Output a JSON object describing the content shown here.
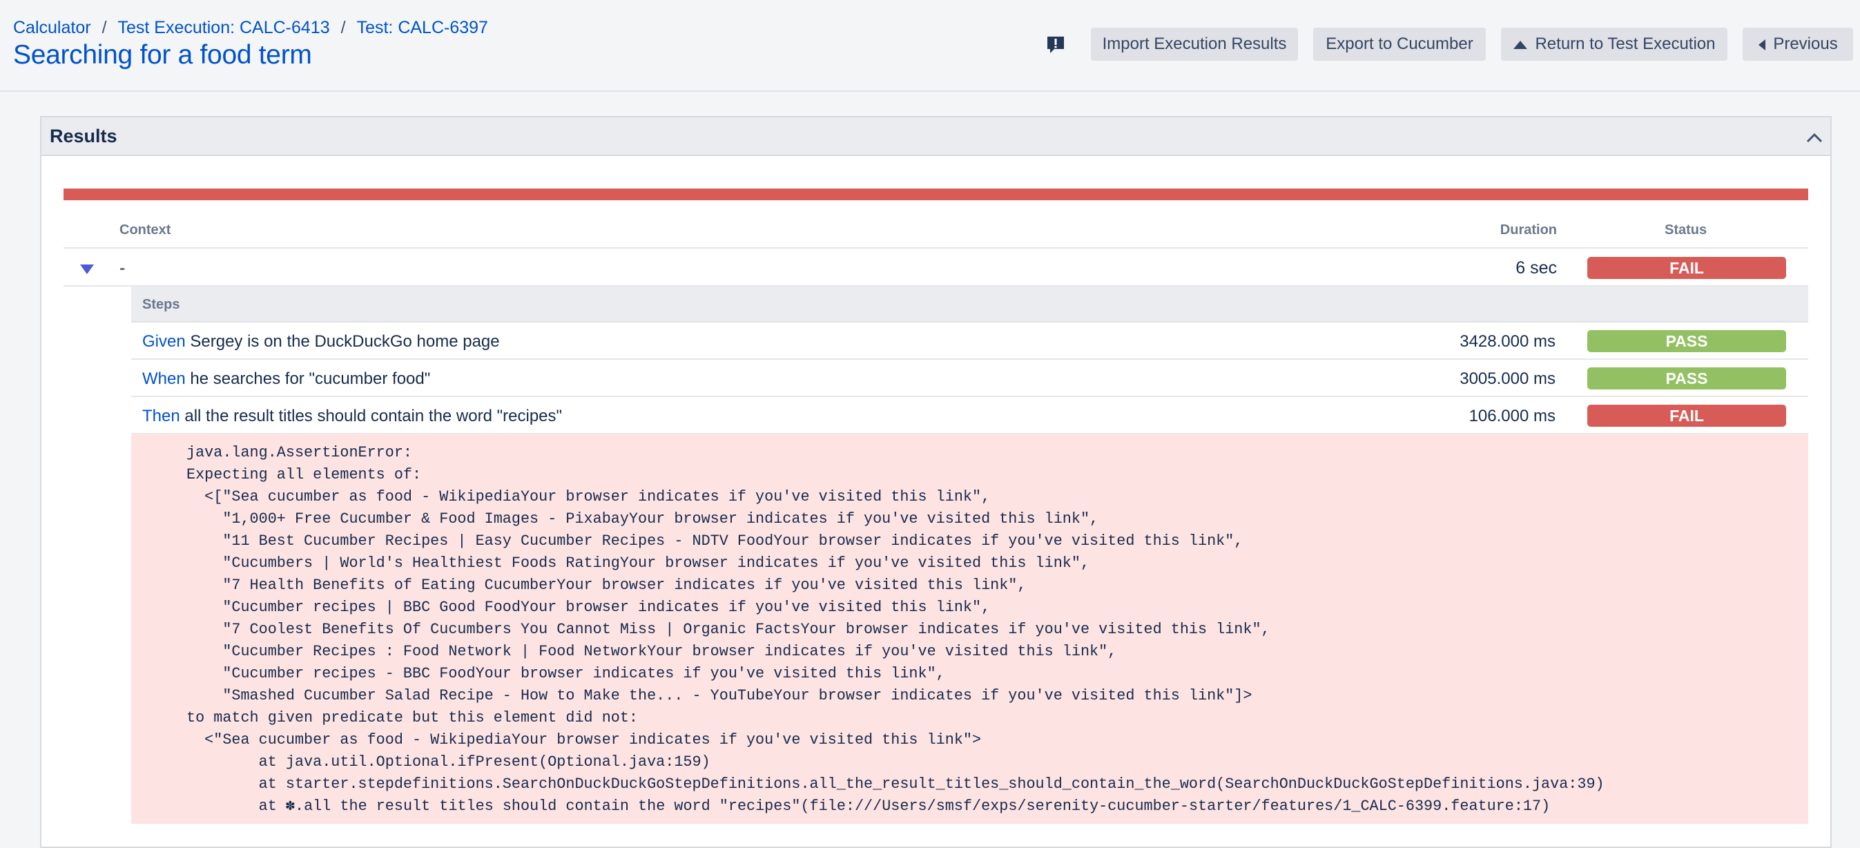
{
  "breadcrumb": {
    "items": [
      "Calculator",
      "Test Execution: CALC-6413",
      "Test: CALC-6397"
    ],
    "separator": "/"
  },
  "page_title": "Searching for a food term",
  "toolbar": {
    "feedback_icon": "feedback-icon",
    "import_label": "Import Execution Results",
    "export_label": "Export to Cucumber",
    "return_label": "Return to Test Execution",
    "return_icon": "up-triangle-icon",
    "previous_label": "Previous",
    "previous_icon": "left-triangle-icon"
  },
  "results": {
    "title": "Results",
    "collapse_icon": "chevron-up-icon",
    "overall_status_color": "#d75c57",
    "columns": {
      "context": "Context",
      "duration": "Duration",
      "status": "Status"
    },
    "context_row": {
      "context": "-",
      "duration": "6 sec",
      "status": "FAIL"
    },
    "steps_header": "Steps",
    "steps": [
      {
        "keyword": "Given",
        "text": " Sergey is on the DuckDuckGo home page",
        "duration": "3428.000 ms",
        "status": "PASS"
      },
      {
        "keyword": "When",
        "text": " he searches for \"cucumber food\"",
        "duration": "3005.000 ms",
        "status": "PASS"
      },
      {
        "keyword": "Then",
        "text": " all the result titles should contain the word \"recipes\"",
        "duration": "106.000 ms",
        "status": "FAIL"
      }
    ],
    "error_lines": [
      "java.lang.AssertionError:",
      "Expecting all elements of:",
      "  <[\"Sea cucumber as food - WikipediaYour browser indicates if you've visited this link\",",
      "    \"1,000+ Free Cucumber & Food Images - PixabayYour browser indicates if you've visited this link\",",
      "    \"11 Best Cucumber Recipes | Easy Cucumber Recipes - NDTV FoodYour browser indicates if you've visited this link\",",
      "    \"Cucumbers | World's Healthiest Foods RatingYour browser indicates if you've visited this link\",",
      "    \"7 Health Benefits of Eating CucumberYour browser indicates if you've visited this link\",",
      "    \"Cucumber recipes | BBC Good FoodYour browser indicates if you've visited this link\",",
      "    \"7 Coolest Benefits Of Cucumbers You Cannot Miss | Organic FactsYour browser indicates if you've visited this link\",",
      "    \"Cucumber Recipes : Food Network | Food NetworkYour browser indicates if you've visited this link\",",
      "    \"Cucumber recipes - BBC FoodYour browser indicates if you've visited this link\",",
      "    \"Smashed Cucumber Salad Recipe - How to Make the... - YouTubeYour browser indicates if you've visited this link\"]>",
      "to match given predicate but this element did not:",
      "  <\"Sea cucumber as food - WikipediaYour browser indicates if you've visited this link\">",
      "        at java.util.Optional.ifPresent(Optional.java:159)",
      "        at starter.stepdefinitions.SearchOnDuckDuckGoStepDefinitions.all_the_result_titles_should_contain_the_word(SearchOnDuckDuckGoStepDefinitions.java:39)",
      "        at ✽.all the result titles should contain the word \"recipes\"(file:///Users/smsf/exps/serenity-cucumber-starter/features/1_CALC-6399.feature:17)"
    ]
  }
}
